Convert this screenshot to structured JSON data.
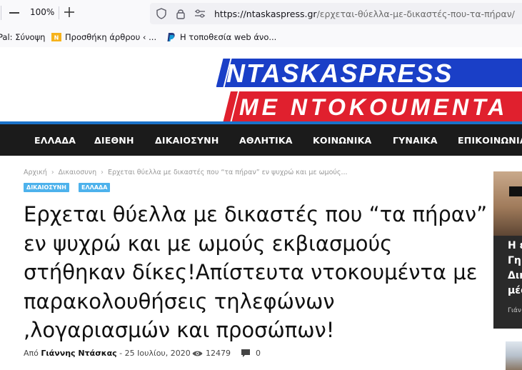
{
  "browser": {
    "zoom": "100%",
    "url_host": "https://ntaskaspress.gr",
    "url_path": "/ερχεται-θύελλα-με-δικαστές-που-τα-πήραν/",
    "bookmarks": [
      {
        "label": "Pal: Σύνοψη"
      },
      {
        "label": "Προσθήκη άρθρου ‹ ..."
      },
      {
        "label": "Η τοποθεσία web άνο..."
      }
    ]
  },
  "site": {
    "logo_top": "NTASKASPRESS",
    "logo_bottom": "ME NTOKOUMENTA",
    "colors": {
      "logo_blue": "#1a3fc7",
      "logo_red": "#e0202e",
      "accent": "#1a72c9",
      "nav_bg": "#1b1b1b",
      "category": "#4db2ec"
    }
  },
  "nav": {
    "items": [
      "ΕΛΛΑΔΑ",
      "ΔΙΕΘΝΗ",
      "ΔΙΚΑΙΟΣΥΝΗ",
      "ΑΘΛΗΤΙΚΑ",
      "ΚΟΙΝΩΝΙΚΑ",
      "ΓΥΝΑΙΚΑ",
      "ΕΠΙΚΟΙΝΩΝΙΑ"
    ]
  },
  "article": {
    "breadcrumb": [
      "Αρχική",
      "Δικαιοσυνη",
      "Ερχεται θύελλα με δικαστές που “τα πήραν” εν ψυχρώ και με ωμούς..."
    ],
    "categories": [
      "ΔΙΚΑΙΟΣΥΝΗ",
      "ΕΛΛΑΔΑ"
    ],
    "headline_lines": [
      "Ερχεται θύελλα με δικαστές που “τα πήραν”",
      "εν ψυχρώ και με ωμούς εκβιασμούς",
      "στήθηκαν δίκες!Απίστευτα ντοκουμέντα με",
      "παρακολουθήσεις τηλεφώνων",
      ",λογαριασμών και προσώπων!"
    ],
    "by_prefix": "Από",
    "author": "Γιάννης Ντάσκας",
    "date_sep": "-",
    "date": "25 Ιουλίου, 2020",
    "views": "12479",
    "comments": "0"
  },
  "sidebar": {
    "card_lines": [
      "Η ε",
      "Γη",
      "Δικ",
      "μέσ"
    ],
    "card_byline": "Γιάν"
  }
}
